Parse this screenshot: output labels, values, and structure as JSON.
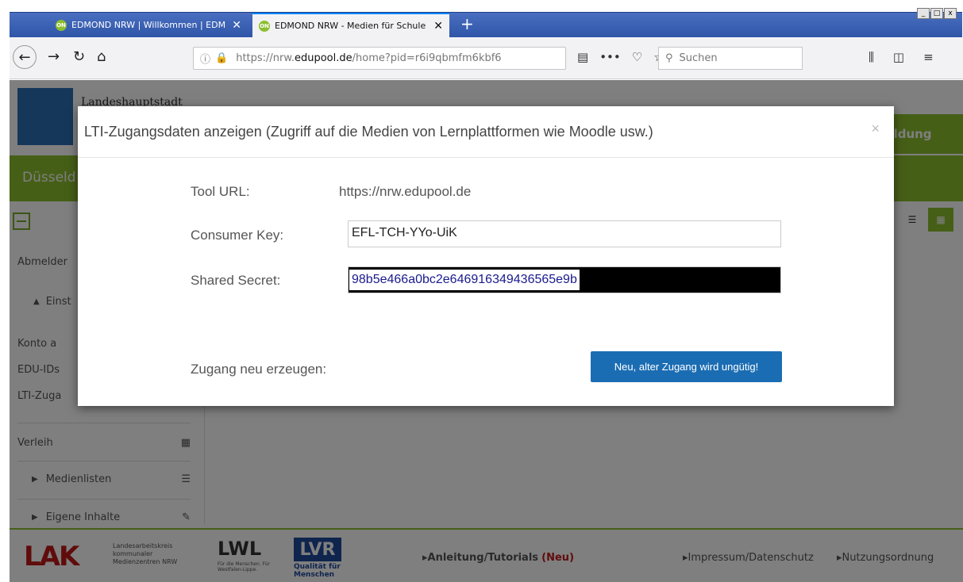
{
  "browser": {
    "tabs": [
      {
        "title": "EDMOND NRW | Willkommen | EDM",
        "favicon": "ON"
      },
      {
        "title": "EDMOND NRW - Medien für Schule",
        "favicon": "ON"
      }
    ],
    "new_tab": "+",
    "url_prefix": "https://nrw.",
    "url_domain": "edupool.de",
    "url_path": "/home?pid=r6i9qbmfm6kbf6",
    "search_placeholder": "Suchen",
    "win_controls": [
      "_",
      "□",
      "x"
    ]
  },
  "page": {
    "header_text": "Landeshauptstadt",
    "header_right": "Bildung",
    "greenbar_text": "Düsseld",
    "sidebar": {
      "items": [
        {
          "label": "Abmelder"
        },
        {
          "label": "Einst"
        },
        {
          "label": "Konto a"
        },
        {
          "label": "EDU-IDs"
        },
        {
          "label": "LTI-Zuga"
        },
        {
          "label": "Verleih"
        },
        {
          "label": "Medienlisten"
        },
        {
          "label": "Eigene Inhalte"
        }
      ]
    },
    "footer": {
      "lak": "LAK",
      "lak_sub": "Landesarbeitskreis kommunaler Medienzentren NRW",
      "lwl": "LWL",
      "lwl_sub": "Für die Menschen. Für Westfalen-Lippe.",
      "lvr": "LVR",
      "lvr_sub": "Qualität für Menschen",
      "tutorials": "Anleitung/Tutorials",
      "tutorials_neu": "(Neu)",
      "impressum": "Impressum/Datenschutz",
      "nutzung": "Nutzungsordnung"
    }
  },
  "modal": {
    "title": "LTI-Zugangsdaten anzeigen (Zugriff auf die Medien von Lernplattformen wie Moodle usw.)",
    "close": "×",
    "tool_url_label": "Tool URL:",
    "tool_url_value": "https://nrw.edupool.de",
    "consumer_key_label": "Consumer Key:",
    "consumer_key_value": "EFL-TCH-YYo-UiK",
    "shared_secret_label": "Shared Secret:",
    "shared_secret_value": "98b5e466a0bc2e646916349436565e9b",
    "regen_label": "Zugang neu erzeugen:",
    "regen_button": "Neu, alter Zugang wird ungütig!"
  },
  "colors": {
    "accent_green": "#8cbf2f",
    "button_blue": "#1b6db3",
    "tab_blue": "#2f55a8"
  }
}
